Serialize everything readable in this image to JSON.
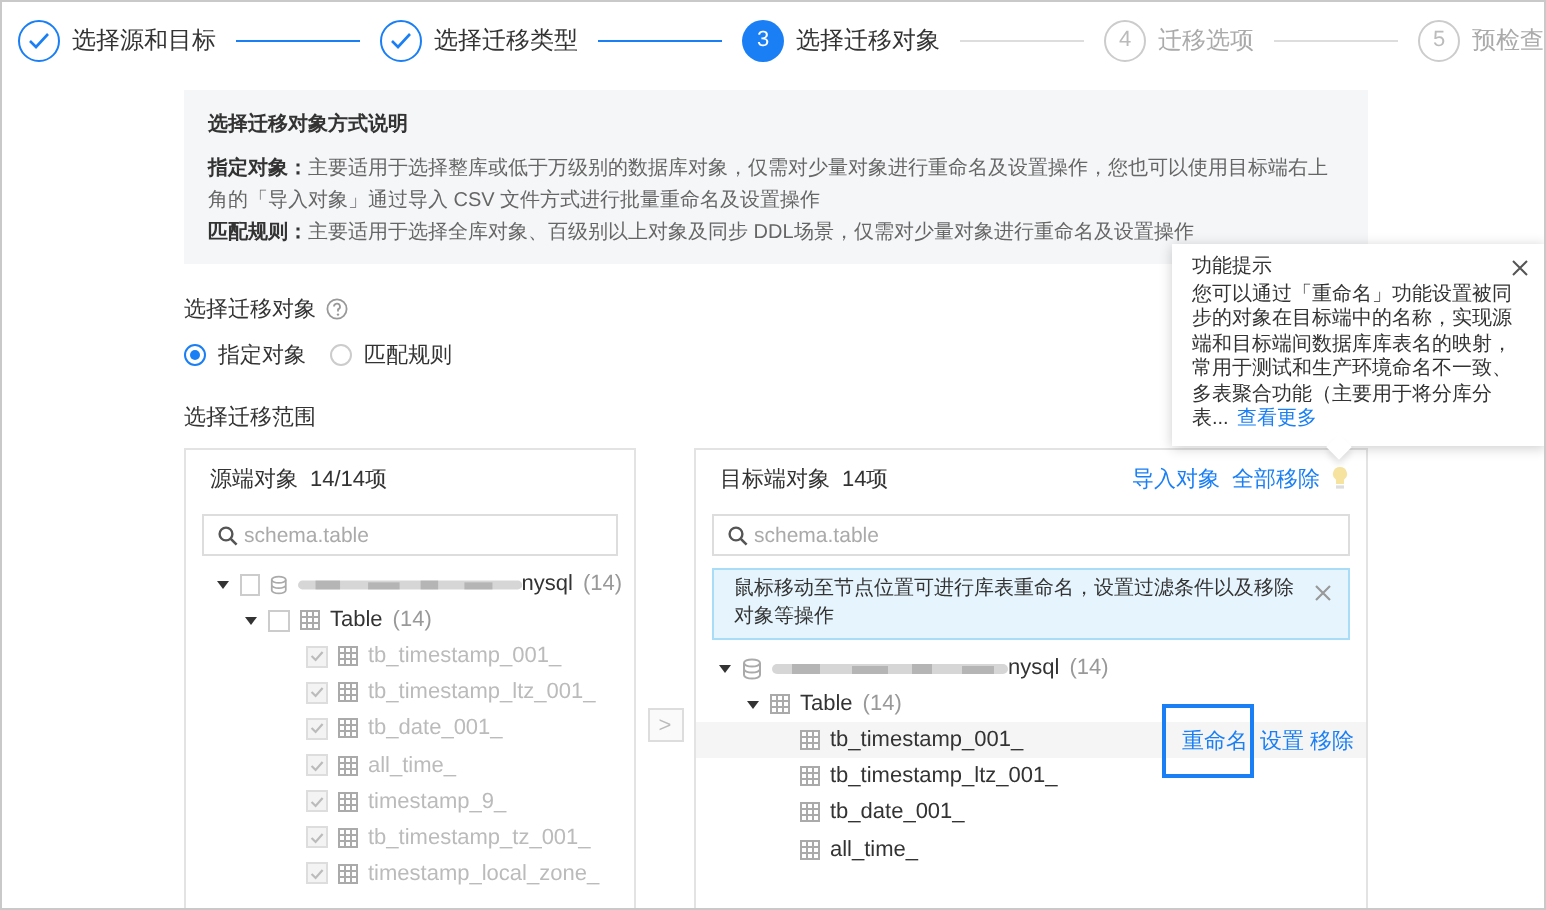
{
  "steps": [
    {
      "label": "选择源和目标",
      "done": true,
      "selected": false
    },
    {
      "label": "选择迁移类型",
      "done": true,
      "selected": false
    },
    {
      "label": "选择迁移对象",
      "done": false,
      "selected": true,
      "number": "3"
    },
    {
      "label": "迁移选项",
      "done": false,
      "selected": false,
      "number": "4"
    },
    {
      "label": "预检查",
      "done": false,
      "selected": false,
      "number": "5"
    }
  ],
  "guide": {
    "title": "选择迁移对象方式说明",
    "paragraphs": [
      "**指定对象：**主要适用于选择整库或低于万级别的数据库对象，仅需对少量对象进行重命名及设置操作，您也可以使用目标端右上角的「导入对象」通过导入 CSV 文件方式进行批量重命名及设置操作",
      "**匹配规则：**主要适用于选择全库对象、百级别以上对象及同步 DDL场景，仅需对少量对象进行重命名及设置操作"
    ]
  },
  "object_mode": {
    "label": "选择迁移对象",
    "options": [
      {
        "label": "指定对象",
        "selected": true
      },
      {
        "label": "匹配规则",
        "selected": false
      }
    ]
  },
  "scope_label": "选择迁移范围",
  "source_panel": {
    "title": "源端对象",
    "count": "14/14项",
    "search": {
      "placeholder": "schema.table"
    },
    "tree": [
      {
        "kind": "database",
        "name": "nysql",
        "count": "(14)",
        "checked": false,
        "expanded": true,
        "disabled": false,
        "children": [
          {
            "kind": "group",
            "name": "Table",
            "count": "(14)",
            "checked": false,
            "expanded": true,
            "disabled": false,
            "children": [
              {
                "kind": "table",
                "name": "tb_timestamp_001_",
                "checked": true,
                "disabled": true
              },
              {
                "kind": "table",
                "name": "tb_timestamp_ltz_001_",
                "checked": true,
                "disabled": true
              },
              {
                "kind": "table",
                "name": "tb_date_001_",
                "checked": true,
                "disabled": true
              },
              {
                "kind": "table",
                "name": "all_time_",
                "checked": true,
                "disabled": true
              },
              {
                "kind": "table",
                "name": "timestamp_9_",
                "checked": true,
                "disabled": true
              },
              {
                "kind": "table",
                "name": "tb_timestamp_tz_001_",
                "checked": true,
                "disabled": true
              },
              {
                "kind": "table",
                "name": "timestamp_local_zone_",
                "checked": true,
                "disabled": true
              }
            ]
          }
        ]
      }
    ]
  },
  "transfer_button": {
    "label": ">",
    "disabled": true
  },
  "target_panel": {
    "title": "目标端对象",
    "count": "14项",
    "links": [
      "导入对象",
      "全部移除"
    ],
    "search": {
      "placeholder": "schema.table"
    },
    "notice": "鼠标移动至节点位置可进行库表重命名，设置过滤条件以及移除对象等操作",
    "tree": [
      {
        "kind": "database",
        "name": "nysql",
        "count": "(14)",
        "expanded": true,
        "children": [
          {
            "kind": "group",
            "name": "Table",
            "count": "(14)",
            "expanded": true,
            "children": [
              {
                "kind": "table",
                "name": "tb_timestamp_001_",
                "hovered": true,
                "actions": [
                  {
                    "label": "重命名",
                    "highlighted": true
                  },
                  {
                    "label": "设置",
                    "highlighted": false
                  },
                  {
                    "label": "移除",
                    "highlighted": false
                  }
                ]
              },
              {
                "kind": "table",
                "name": "tb_timestamp_ltz_001_",
                "hovered": false
              },
              {
                "kind": "table",
                "name": "tb_date_001_",
                "hovered": false
              },
              {
                "kind": "table",
                "name": "all_time_",
                "hovered": false
              }
            ]
          }
        ]
      }
    ]
  },
  "tooltip": {
    "title": "功能提示",
    "text": "您可以通过「重命名」功能设置被同步的对象在目标端中的名称，实现源端和目标端间数据库库表名的映射，常用于测试和生产环境命名不一致、多表聚合功能（主要用于将分库分表...",
    "link": "查看更多"
  }
}
